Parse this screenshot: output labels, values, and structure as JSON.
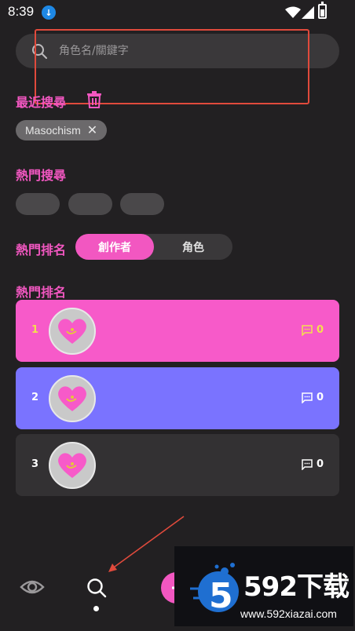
{
  "status_bar": {
    "time": "8:39"
  },
  "search": {
    "placeholder": "角色名/關鍵字"
  },
  "recent": {
    "title": "最近搜尋",
    "chips": [
      {
        "label": "Masochism",
        "close": "✕"
      }
    ]
  },
  "hot_search": {
    "title": "熱門搜尋",
    "chip_count": 3
  },
  "rank_toggle": {
    "title": "熱門排名",
    "options": [
      {
        "label": "創作者",
        "active": true
      },
      {
        "label": "角色",
        "active": false
      }
    ]
  },
  "rank_list": {
    "title": "熱門排名",
    "items": [
      {
        "rank": "1",
        "comments": "0",
        "color": "#f75ac9",
        "text_color": "#f4e04d"
      },
      {
        "rank": "2",
        "comments": "0",
        "color": "#7a73ff",
        "text_color": "#ffffff"
      },
      {
        "rank": "3",
        "comments": "0",
        "color": "#333133",
        "text_color": "#ffffff"
      }
    ]
  },
  "bottom_nav": {
    "items": [
      {
        "icon": "eye-icon"
      },
      {
        "icon": "search-icon",
        "active": true
      },
      {
        "icon": "add-icon"
      }
    ]
  },
  "watermark": {
    "brand": "592下载",
    "url": "www.592xiazai.com"
  },
  "colors": {
    "accent": "#f257c1",
    "background": "#222022",
    "annotation": "#e04a3c"
  }
}
